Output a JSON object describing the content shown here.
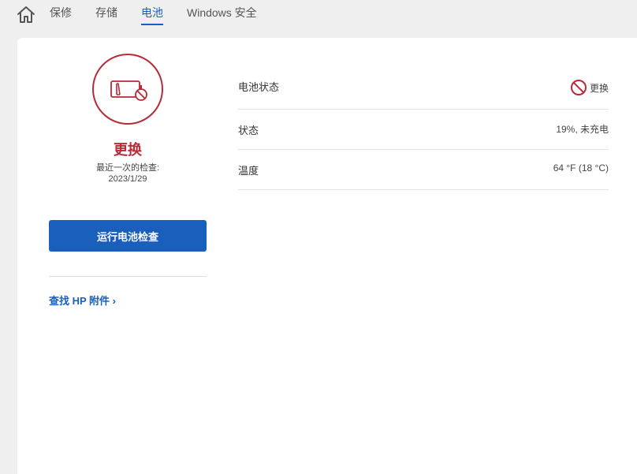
{
  "nav": {
    "tabs": [
      {
        "label": "保修"
      },
      {
        "label": "存储"
      },
      {
        "label": "电池"
      },
      {
        "label": "Windows 安全"
      }
    ],
    "active_tab": "电池"
  },
  "battery": {
    "status_title": "更换",
    "last_check_label": "最近一次的检查:",
    "last_check_date": "2023/1/29",
    "run_check_label": "运行电池检查",
    "accessories_link": "查找 HP 附件 ›"
  },
  "details": {
    "rows": [
      {
        "label": "电池状态",
        "value": "更换",
        "icon": "prohibited-icon"
      },
      {
        "label": "状态",
        "value": "19%, 未充电"
      },
      {
        "label": "温度",
        "value": "64 °F (18 °C)"
      }
    ]
  },
  "colors": {
    "accent": "#1b5fbd",
    "alert": "#b52b36"
  }
}
